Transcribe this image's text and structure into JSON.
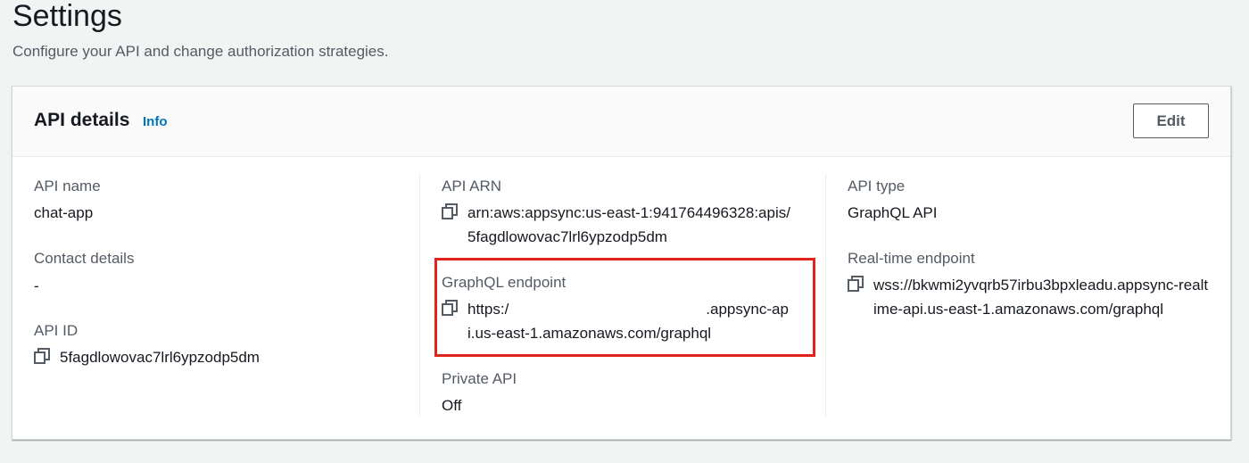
{
  "page": {
    "title": "Settings",
    "subtitle": "Configure your API and change authorization strategies."
  },
  "card": {
    "title": "API details",
    "info_label": "Info",
    "edit_label": "Edit"
  },
  "col1": {
    "api_name_label": "API name",
    "api_name_value": "chat-app",
    "contact_label": "Contact details",
    "contact_value": "-",
    "api_id_label": "API ID",
    "api_id_value": "5fagdlowovac7lrl6ypzodp5dm"
  },
  "col2": {
    "api_arn_label": "API ARN",
    "api_arn_value": "arn:aws:appsync:us-east-1:941764496328:apis/5fagdlowovac7lrl6ypzodp5dm",
    "graphql_label": "GraphQL endpoint",
    "graphql_value": "https:/                          .appsync-api.us-east-1.amazonaws.com/graphql",
    "private_label": "Private API",
    "private_value": "Off"
  },
  "col3": {
    "api_type_label": "API type",
    "api_type_value": "GraphQL API",
    "realtime_label": "Real-time endpoint",
    "realtime_value": "wss://bkwmi2yvqrb57irbu3bpxleadu.appsync-realtime-api.us-east-1.amazonaws.com/graphql"
  },
  "icons": {
    "copy": "copy-icon"
  },
  "colors": {
    "link": "#0073bb",
    "highlight": "#e2231a"
  }
}
